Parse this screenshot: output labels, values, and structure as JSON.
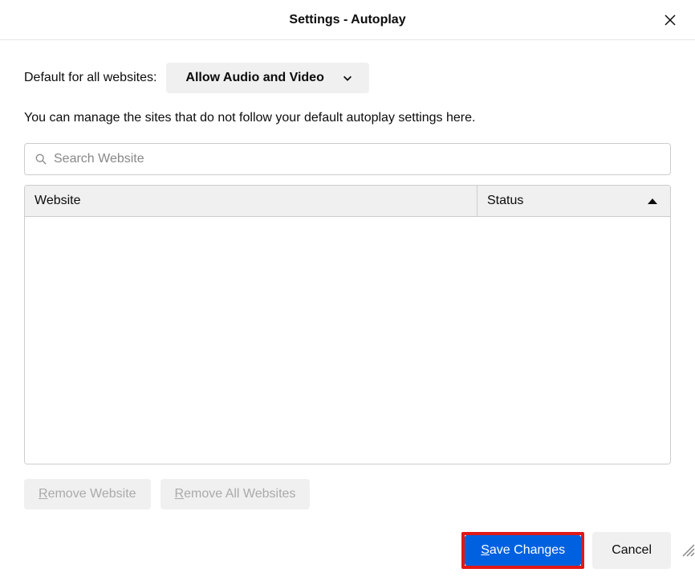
{
  "dialog": {
    "title": "Settings - Autoplay"
  },
  "default": {
    "label": "Default for all websites:",
    "selected": "Allow Audio and Video"
  },
  "description": "You can manage the sites that do not follow your default autoplay settings here.",
  "search": {
    "placeholder": "Search Website"
  },
  "table": {
    "columns": {
      "website": "Website",
      "status": "Status"
    },
    "rows": []
  },
  "buttons": {
    "remove_website": "Remove Website",
    "remove_all": "Remove All Websites",
    "save_changes": "Save Changes",
    "cancel": "Cancel"
  }
}
